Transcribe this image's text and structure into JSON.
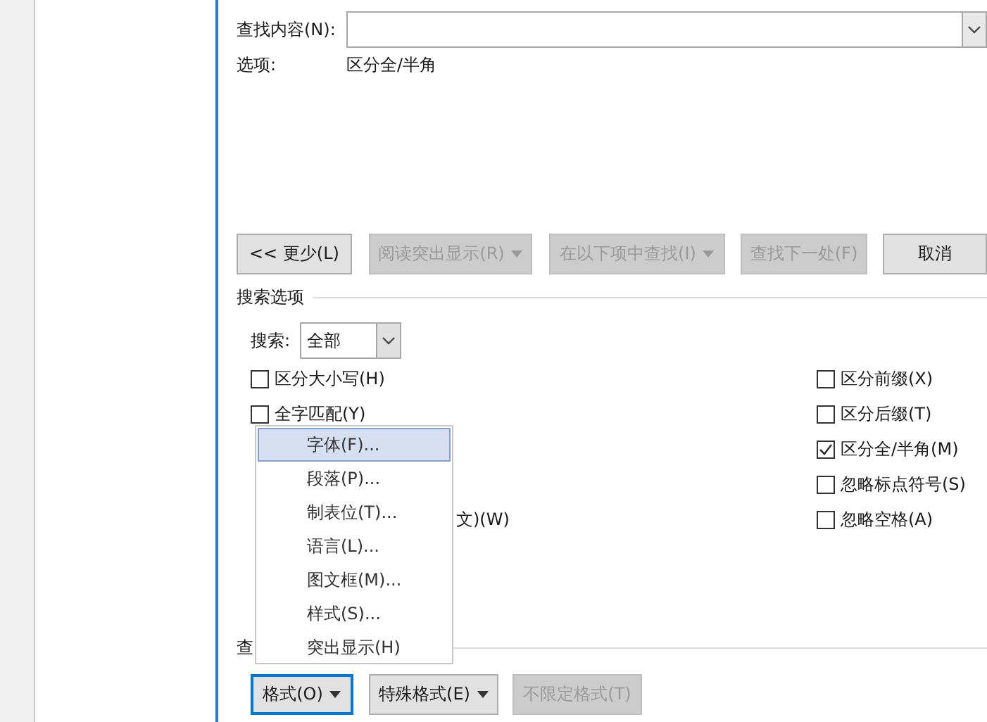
{
  "find": {
    "label": "查找内容(N):"
  },
  "options": {
    "label": "选项:",
    "value": "区分全/半角"
  },
  "buttons": [
    {
      "label": "<< 更少(L)",
      "disabled": false,
      "dropdown": false
    },
    {
      "label": "阅读突出显示(R)",
      "disabled": true,
      "dropdown": true
    },
    {
      "label": "在以下项中查找(I)",
      "disabled": true,
      "dropdown": true
    },
    {
      "label": "查找下一处(F)",
      "disabled": true,
      "dropdown": false
    },
    {
      "label": "取消",
      "disabled": false,
      "dropdown": false
    }
  ],
  "search_options": {
    "title": "搜索选项",
    "search_label": "搜索:",
    "search_value": "全部"
  },
  "checkboxes_left": [
    {
      "label": "区分大小写(H)",
      "checked": false
    },
    {
      "label": "全字匹配(Y)",
      "checked": false
    }
  ],
  "covered_row_text": "文)(W)",
  "checkboxes_right": [
    {
      "label": "区分前缀(X)",
      "checked": false
    },
    {
      "label": "区分后缀(T)",
      "checked": false
    },
    {
      "label": "区分全/半角(M)",
      "checked": true
    },
    {
      "label": "忽略标点符号(S)",
      "checked": false
    },
    {
      "label": "忽略空格(A)",
      "checked": false
    }
  ],
  "replace_section_label": "查",
  "bottom_buttons": [
    {
      "label": "格式(O)",
      "disabled": false,
      "dropdown": true,
      "focused": true
    },
    {
      "label": "特殊格式(E)",
      "disabled": false,
      "dropdown": true,
      "focused": false
    },
    {
      "label": "不限定格式(T)",
      "disabled": true,
      "dropdown": false,
      "focused": false
    }
  ],
  "menu": [
    {
      "label": "字体(F)...",
      "selected": true
    },
    {
      "label": "段落(P)...",
      "selected": false
    },
    {
      "label": "制表位(T)...",
      "selected": false
    },
    {
      "label": "语言(L)...",
      "selected": false
    },
    {
      "label": "图文框(M)...",
      "selected": false
    },
    {
      "label": "样式(S)...",
      "selected": false
    },
    {
      "label": "突出显示(H)",
      "selected": false
    }
  ]
}
